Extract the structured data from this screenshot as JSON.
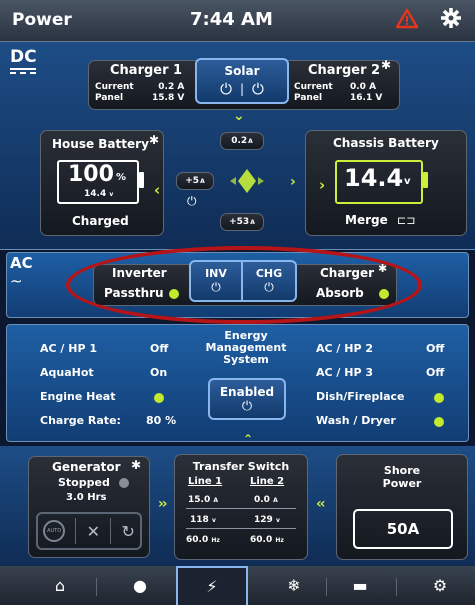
{
  "topbar": {
    "title": "Power",
    "time": "7:44 AM",
    "alert_icon": "warning-icon",
    "settings_icon": "gear-icon"
  },
  "dc": {
    "label": "DC",
    "charger1": {
      "title": "Charger 1",
      "current_label": "Current",
      "current_value": "0.2 A",
      "panel_label": "Panel",
      "panel_value": "15.8 V"
    },
    "solar": {
      "title": "Solar",
      "sep": "|"
    },
    "charger2": {
      "title": "Charger 2",
      "current_label": "Current",
      "current_value": "0.0 A",
      "panel_label": "Panel",
      "panel_value": "16.1 V"
    },
    "house_battery": {
      "title": "House Battery",
      "percent": "100",
      "percent_unit": "%",
      "voltage": "14.4",
      "voltage_unit": "v",
      "status": "Charged"
    },
    "chassis_battery": {
      "title": "Chassis Battery",
      "voltage": "14.4",
      "voltage_unit": "v",
      "status": "Merge"
    },
    "flow": {
      "top": "0.2",
      "top_unit": "A",
      "left": "+5",
      "left_unit": "A",
      "bottom": "+53",
      "bottom_unit": "A"
    }
  },
  "ac": {
    "label": "AC",
    "inverter": {
      "title": "Inverter",
      "status": "Passthru"
    },
    "inv_label": "INV",
    "chg_label": "CHG",
    "charger": {
      "title": "Charger",
      "status": "Absorb"
    }
  },
  "ems": {
    "left": [
      {
        "label": "AC / HP 1",
        "value": "Off"
      },
      {
        "label": "AquaHot",
        "value": "On"
      },
      {
        "label": "Engine Heat",
        "value": ""
      },
      {
        "label": "Charge Rate:",
        "value": "80 %"
      }
    ],
    "center": {
      "title_line1": "Energy",
      "title_line2": "Management",
      "title_line3": "System",
      "button": "Enabled"
    },
    "right": [
      {
        "label": "AC / HP 2",
        "value": "Off"
      },
      {
        "label": "AC / HP 3",
        "value": "Off"
      },
      {
        "label": "Dish/Fireplace",
        "value": ""
      },
      {
        "label": "Wash / Dryer",
        "value": ""
      }
    ]
  },
  "generator": {
    "title": "Generator",
    "status": "Stopped",
    "hours": "3.0 Hrs",
    "auto_label": "AUTO"
  },
  "transfer": {
    "title": "Transfer Switch",
    "line1": {
      "title": "Line 1",
      "amps": "15.0",
      "volts": "118",
      "hz": "60.0"
    },
    "line2": {
      "title": "Line 2",
      "amps": "0.0",
      "volts": "129",
      "hz": "60.0"
    },
    "amp_unit": "A",
    "volt_unit": "v",
    "hz_unit": "Hz"
  },
  "shore": {
    "title_line1": "Shore",
    "title_line2": "Power",
    "value": "50A"
  },
  "nav": [
    "home-icon",
    "lightbulb-icon",
    "power-bolt-icon",
    "snowflake-icon",
    "rv-icon",
    "tools-icon"
  ],
  "colors": {
    "accent": "#c9ef3a",
    "highlight_ring": "#b61416",
    "panel_blue": "#1e5fa4"
  }
}
